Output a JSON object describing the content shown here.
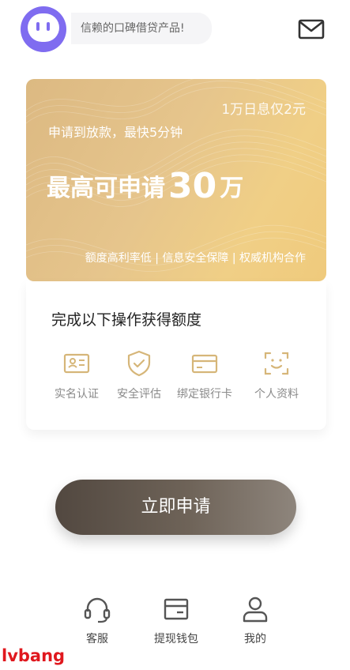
{
  "header": {
    "tagline": "信赖的口碑借贷产品!",
    "avatar_icon": "robot-face-icon",
    "mail_icon": "mail-icon"
  },
  "promo_card": {
    "corner_text": "1万日息仅2元",
    "subtitle": "申请到放款，最快5分钟",
    "headline_prefix": "最高可申请",
    "headline_amount": "30",
    "headline_unit": "万",
    "features": "额度高利率低 | 信息安全保障 | 权威机构合作"
  },
  "steps_panel": {
    "title": "完成以下操作获得额度",
    "steps": [
      {
        "label": "实名认证",
        "icon": "id-card-icon"
      },
      {
        "label": "安全评估",
        "icon": "shield-check-icon"
      },
      {
        "label": "绑定银行卡",
        "icon": "bank-card-icon"
      },
      {
        "label": "个人资料",
        "icon": "face-scan-icon"
      }
    ]
  },
  "apply_button": {
    "label": "立即申请"
  },
  "bottom_nav": {
    "items": [
      {
        "label": "客服",
        "icon": "headset-icon"
      },
      {
        "label": "提现钱包",
        "icon": "wallet-icon"
      },
      {
        "label": "我的",
        "icon": "user-icon"
      }
    ]
  },
  "watermark": "lvbang",
  "colors": {
    "accent_gold": "#e6c58c",
    "step_icon": "#d6b679",
    "button_dark": "#524840",
    "avatar": "#7f6cf0",
    "watermark": "#e0181e"
  }
}
